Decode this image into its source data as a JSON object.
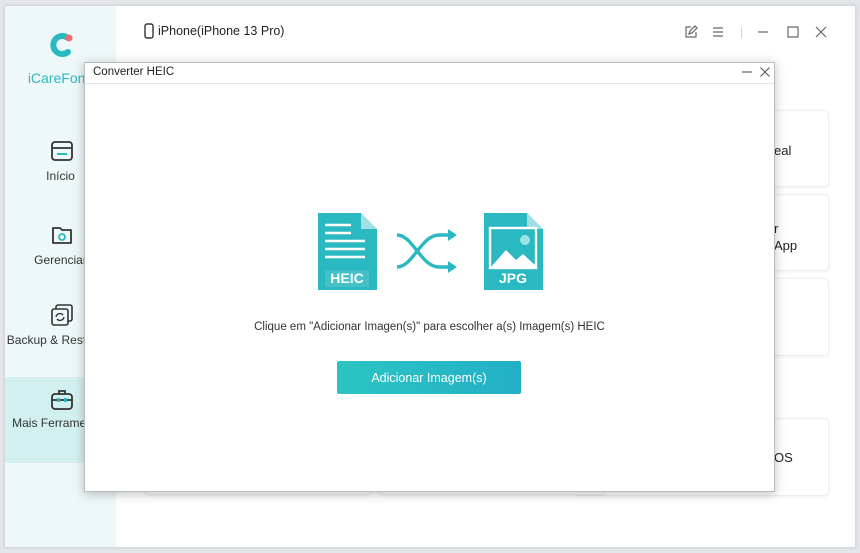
{
  "app": {
    "brand": "iCareFone",
    "device": "iPhone(iPhone 13 Pro)"
  },
  "sidebar": {
    "items": [
      {
        "label": "Início",
        "icon": "home-icon",
        "active": false
      },
      {
        "label": "Gerenciar",
        "icon": "folder-gear-icon",
        "active": false
      },
      {
        "label": "Backup & Restaurar",
        "icon": "backup-restore-icon",
        "active": false
      },
      {
        "label": "Mais Ferramentas",
        "icon": "toolbox-icon",
        "active": true
      }
    ]
  },
  "background_cards": {
    "card1_text": "eal",
    "card2_line1": "r",
    "card2_line2": "App",
    "card4_text": "OS"
  },
  "dialog": {
    "title": "Converter HEIC",
    "heic_label": "HEIC",
    "jpg_label": "JPG",
    "instruction": "Clique em \"Adicionar Imagen(s)\" para escolher a(s) Imagem(s) HEIC",
    "button_label": "Adicionar Imagem(s)"
  },
  "colors": {
    "accent": "#2bb9c1",
    "button_start": "#2cc4c3",
    "button_end": "#22b0c6",
    "sidebar_bg": "#eef8f8",
    "sidebar_active": "#d3f0f1"
  }
}
